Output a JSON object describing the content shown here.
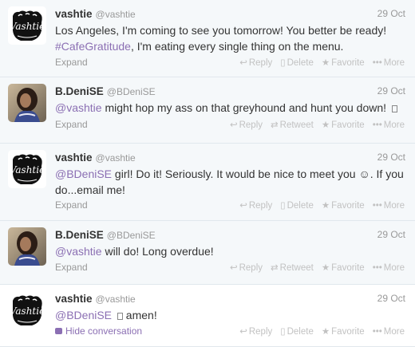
{
  "tweets": [
    {
      "name": "vashtie",
      "handle": "@vashtie",
      "time": "29 Oct",
      "avatar": "fist-logo",
      "text_parts": [
        {
          "t": "Los Angeles, I'm coming to see you tomorrow! You better be ready! "
        },
        {
          "t": "#CafeGratitude",
          "link": true
        },
        {
          "t": ", I'm eating every single thing on the menu."
        }
      ],
      "expand": "Expand",
      "actions": {
        "reply": "Reply",
        "delete": "Delete",
        "favorite": "Favorite",
        "more": "More"
      }
    },
    {
      "name": "B.DeniSE",
      "handle": "@BDeniSE",
      "time": "29 Oct",
      "avatar": "photo",
      "text_parts": [
        {
          "t": "@vashtie",
          "link": true
        },
        {
          "t": " might hop my ass on that greyhound and hunt you down! "
        },
        {
          "t": "",
          "emoji": true
        }
      ],
      "expand": "Expand",
      "actions": {
        "reply": "Reply",
        "retweet": "Retweet",
        "favorite": "Favorite",
        "more": "More"
      }
    },
    {
      "name": "vashtie",
      "handle": "@vashtie",
      "time": "29 Oct",
      "avatar": "fist-logo",
      "text_parts": [
        {
          "t": "@BDeniSE",
          "link": true
        },
        {
          "t": " girl! Do it! Seriously. It would be nice to meet you ☺. If you do...email me!"
        }
      ],
      "expand": "Expand",
      "actions": {
        "reply": "Reply",
        "delete": "Delete",
        "favorite": "Favorite",
        "more": "More"
      }
    },
    {
      "name": "B.DeniSE",
      "handle": "@BDeniSE",
      "time": "29 Oct",
      "avatar": "photo",
      "text_parts": [
        {
          "t": "@vashtie",
          "link": true
        },
        {
          "t": " will do! Long overdue!"
        }
      ],
      "expand": "Expand",
      "actions": {
        "reply": "Reply",
        "retweet": "Retweet",
        "favorite": "Favorite",
        "more": "More"
      }
    },
    {
      "name": "vashtie",
      "handle": "@vashtie",
      "time": "29 Oct",
      "avatar": "fist-logo",
      "text_parts": [
        {
          "t": "@BDeniSE",
          "link": true
        },
        {
          "t": " "
        },
        {
          "t": "",
          "emoji": true
        },
        {
          "t": " amen!"
        }
      ],
      "expand": "Hide conversation",
      "actions": {
        "reply": "Reply",
        "delete": "Delete",
        "favorite": "Favorite",
        "more": "More"
      }
    }
  ],
  "colors": {
    "link": "#8b6fb3",
    "muted": "#999999",
    "action": "#c2c2c2",
    "border": "#e1e8ed"
  },
  "icons": {
    "reply": "reply-arrow-icon",
    "delete": "trash-icon",
    "retweet": "retweet-icon",
    "favorite": "star-icon",
    "more": "dots-icon"
  }
}
